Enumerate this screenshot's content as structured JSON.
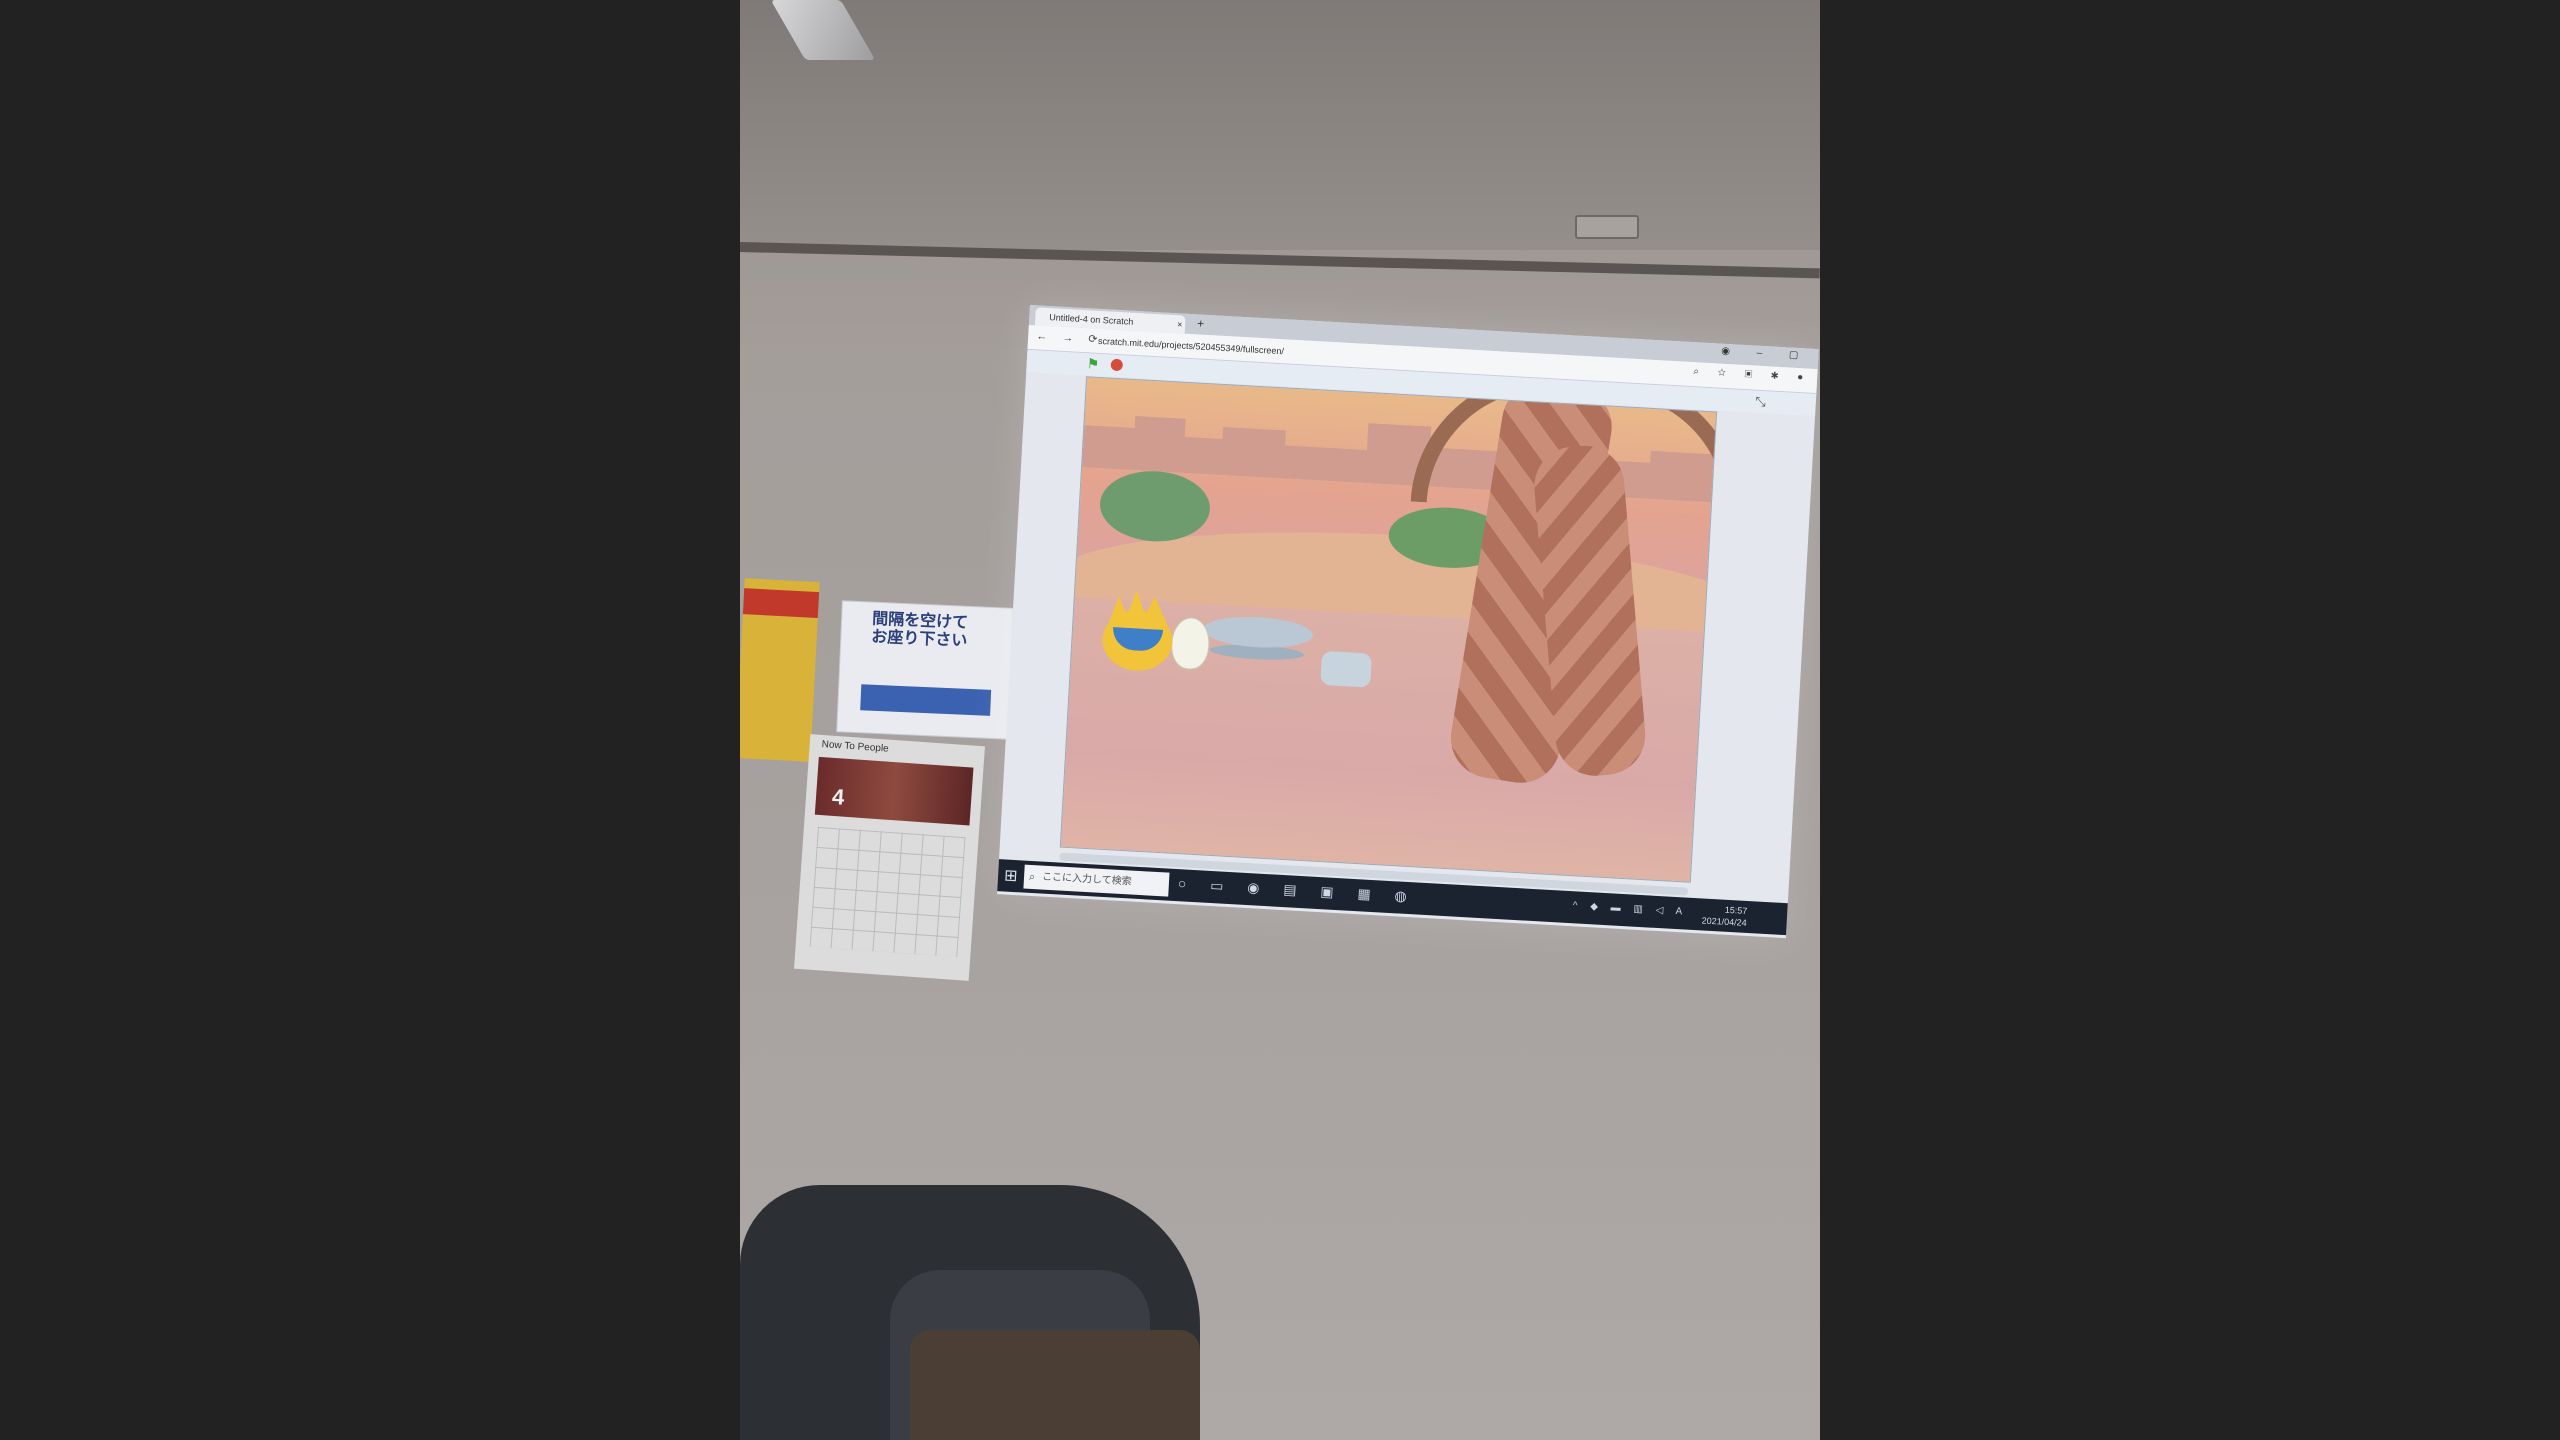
{
  "browser": {
    "tab_title": "Untitled-4 on Scratch",
    "tab_close": "×",
    "new_tab": "+",
    "window_controls": "◉ – ▢",
    "nav_buttons": "← → ⟳",
    "url": "scratch.mit.edu/projects/520455349/fullscreen/",
    "toolbar_icons": "⌕ ☆ ▣ ✱ ●"
  },
  "player": {
    "green_flag_icon": "⚑",
    "fullscreen_icon": "⤡"
  },
  "taskbar": {
    "start_icon": "⊞",
    "search_icon": "⌕",
    "search_placeholder": "ここに入力して検索",
    "task_icons": "○ ▭ ◉ ▤ ▣ ▦ ◍",
    "tray_icons": "^ ◆ ▬ ▥ ◁ A",
    "time": "15:57",
    "date": "2021/04/24"
  },
  "posters": {
    "distance_text": "間隔を空けて\nお座り下さい",
    "calendar_title": "Now To People",
    "calendar_month": "4"
  }
}
